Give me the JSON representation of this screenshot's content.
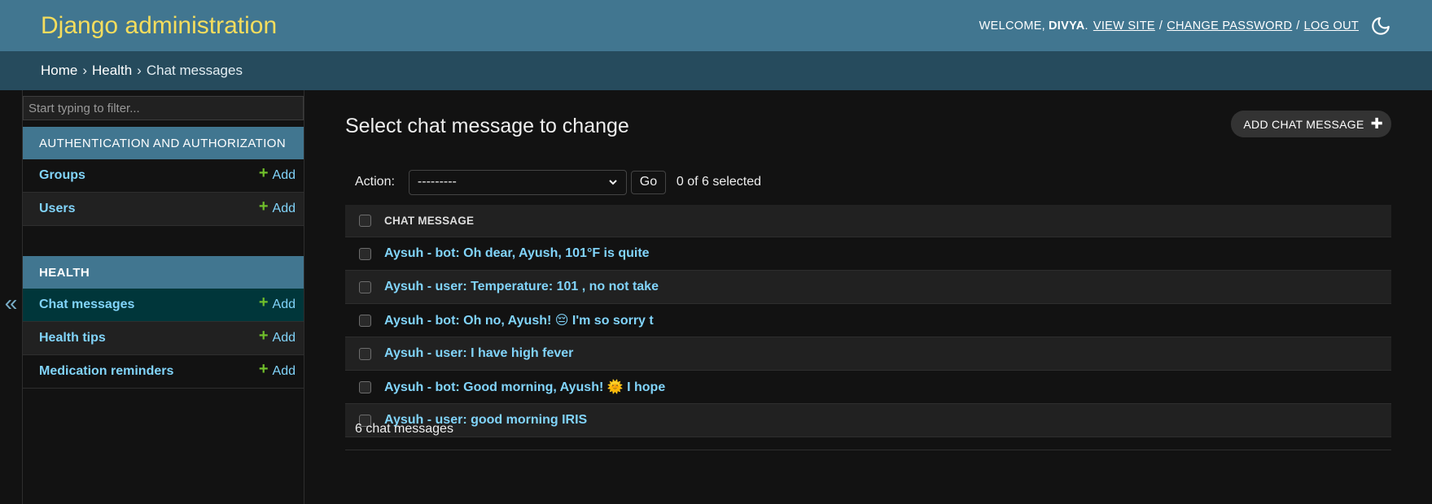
{
  "header": {
    "site_name": "Django administration",
    "welcome": "Welcome,",
    "username": "Divya",
    "username_suffix": ".",
    "view_site": "View site",
    "change_password": "Change password",
    "log_out": "Log out",
    "sep": "/",
    "theme_icon": "moon-icon"
  },
  "breadcrumbs": {
    "home": "Home",
    "app": "Health",
    "current": "Chat messages",
    "arrow": "›"
  },
  "sidebar": {
    "filter_placeholder": "Start typing to filter...",
    "collapse_glyph": "«",
    "add_label": "Add",
    "modules": [
      {
        "caption": "Authentication and Authorization",
        "items": [
          {
            "label": "Groups"
          },
          {
            "label": "Users"
          }
        ]
      },
      {
        "caption": "Health",
        "items": [
          {
            "label": "Chat messages",
            "current": true
          },
          {
            "label": "Health tips"
          },
          {
            "label": "Medication reminders"
          }
        ]
      }
    ]
  },
  "content": {
    "title": "Select chat message to change",
    "add_button": "Add chat message",
    "action_label": "Action:",
    "action_selected": "---------",
    "go_label": "Go",
    "counter": "0 of 6 selected",
    "column_header": "Chat message",
    "rows": [
      "Aysuh - bot: Oh dear, Ayush, 101°F is quite",
      "Aysuh - user: Temperature: 101 , no not take",
      "Aysuh - bot: Oh no, Ayush! 😔 I'm so sorry t",
      "Aysuh - user: I have high fever",
      "Aysuh - bot: Good morning, Ayush! 🌞 I hope",
      "Aysuh - user: good morning IRIS"
    ],
    "result_count": "6 chat messages"
  },
  "colors": {
    "header_bg": "#417690",
    "branding": "#f5dd5d",
    "breadcrumbs_bg": "#264b5d",
    "link": "#81d4fa",
    "add_plus": "#70bf2b",
    "current_row": "#00363a"
  }
}
